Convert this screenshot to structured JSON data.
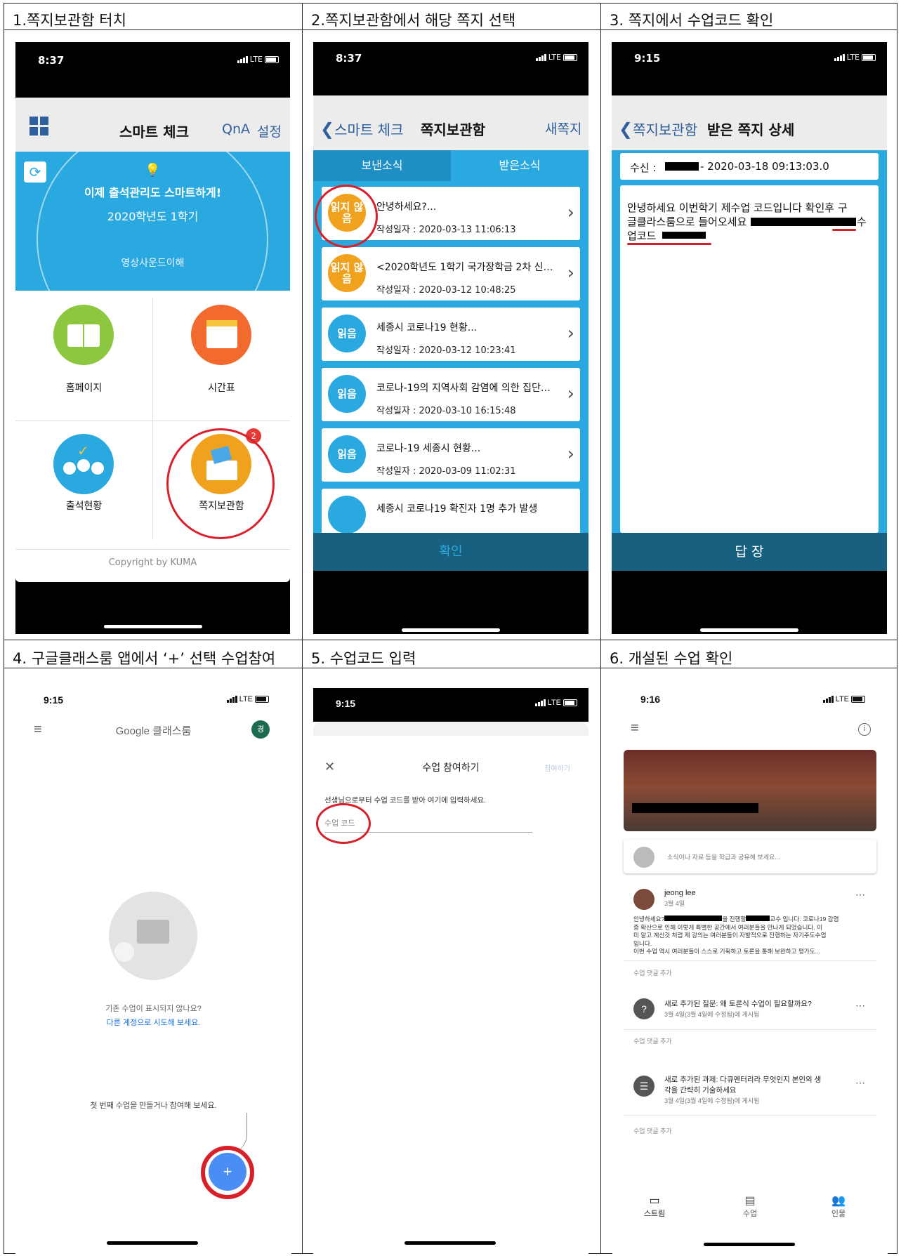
{
  "headers": {
    "h1": "1.쪽지보관함 터치",
    "h2": "2.쪽지보관함에서 해당 쪽지 선택",
    "h3": "3. 쪽지에서 수업코드 확인",
    "h4": "4. 구글클래스룸 앱에서 ‘+’ 선택 수업참여",
    "h5": "5. 수업코드 입력",
    "h6": "6. 개설된 수업 확인"
  },
  "status": {
    "t1": "8:37",
    "t2": "8:37",
    "t3": "9:15",
    "t4": "9:15",
    "t5": "9:15",
    "t6": "9:16",
    "net": "LTE"
  },
  "p1": {
    "title": "스마트 체크",
    "qna": "QnA",
    "settings": "설정",
    "banner_title": "이제 출석관리도 스마트하게!",
    "semester": "2020학년도 1학기",
    "course": "영상사운드이해",
    "menu": [
      "홈페이지",
      "시간표",
      "출석현황",
      "쪽지보관함"
    ],
    "badge_count": "2",
    "copyright": "Copyright by KUMA"
  },
  "p2": {
    "back": "스마트 체크",
    "title": "쪽지보관함",
    "new": "새쪽지",
    "tab_sent": "보낸소식",
    "tab_recv": "받은소식",
    "unread": "읽지 않음",
    "read": "읽음",
    "messages": [
      {
        "title": "안녕하세요?...",
        "date": "작성일자 : 2020-03-13 11:06:13"
      },
      {
        "title": "<2020학년도 1학기 국가장학금 2차 신…",
        "date": "작성일자 : 2020-03-12 10:48:25"
      },
      {
        "title": "세종시 코로나19 현황...",
        "date": "작성일자 : 2020-03-12 10:23:41"
      },
      {
        "title": "코로나-19의 지역사회 감염에 의한 집단…",
        "date": "작성일자 : 2020-03-10 16:15:48"
      },
      {
        "title": "코로나-19 세종시 현황...",
        "date": "작성일자 : 2020-03-09 11:02:31"
      },
      {
        "title": "세종시 코로나19 확진자 1명 추가 발생",
        "date": ""
      }
    ],
    "confirm": "확인"
  },
  "p3": {
    "back": "쪽지보관함",
    "title": "받은 쪽지 상세",
    "recv_label": "수신 :",
    "recv_date": "- 2020-03-18 09:13:03.0",
    "body1": "안녕하세요 이번학기 제수업 코드입니다 확인후 구",
    "body2": "글클라스룸으로 들어오세요",
    "body2_end": "수",
    "body3": "업코드",
    "reply": "답 장"
  },
  "p4": {
    "app_title": "Google 클래스룸",
    "avatar": "경",
    "empty1": "기존 수업이 표시되지 않나요?",
    "empty2": "다른 계정으로 시도해 보세요.",
    "hint": "첫 번째 수업을 만들거나 참여해 보세요.",
    "fab": "+"
  },
  "p5": {
    "title": "수업 참여하기",
    "join": "참여하기",
    "instr": "선생님으로부터 수업 코드를 받아 여기에 입력하세요.",
    "placeholder": "수업 코드"
  },
  "p6": {
    "share": "소식이나 자료 등을 학급과 공유해 보세요...",
    "post_author": "jeong lee",
    "post_date": "3월 4일",
    "post_l1a": "안녕하세요?",
    "post_l1b": "을 진행할",
    "post_l1c": "교수 입니다. 코로나19 감염",
    "post_l2": "증 확산으로 인해 이렇게 특별한 공간에서 여러분들을 만나게 되었습니다. 이",
    "post_l3": "미 알고 계신것 처럼 제 강의는 여러분들이 자발적으로 진행하는 자기주도수업",
    "post_l4": "입니다.",
    "post_l5": "이번 수업 역시 여러분들이 스스로 기획하고 토론을 통해 보완하고 평가도...",
    "comment": "수업 댓글 추가",
    "q_title": "새로 추가된 질문: 왜 토론식 수업이 필요할까요?",
    "q_date": "3월 4일(3월 4일에 수정됨)에 게시됨",
    "a_title1": "새로 추가된 과제: 다큐멘터리라 무엇인지 본인의 생",
    "a_title2": "각을 간략히 기술하세요",
    "a_date": "3월 4일(3월 4일에 수정됨)에 게시됨",
    "nav": [
      "스트림",
      "수업",
      "인물"
    ]
  },
  "colors": {
    "accent_blue": "#2aa9e0",
    "orange": "#f0a21e",
    "red_mark": "#d8202a"
  }
}
